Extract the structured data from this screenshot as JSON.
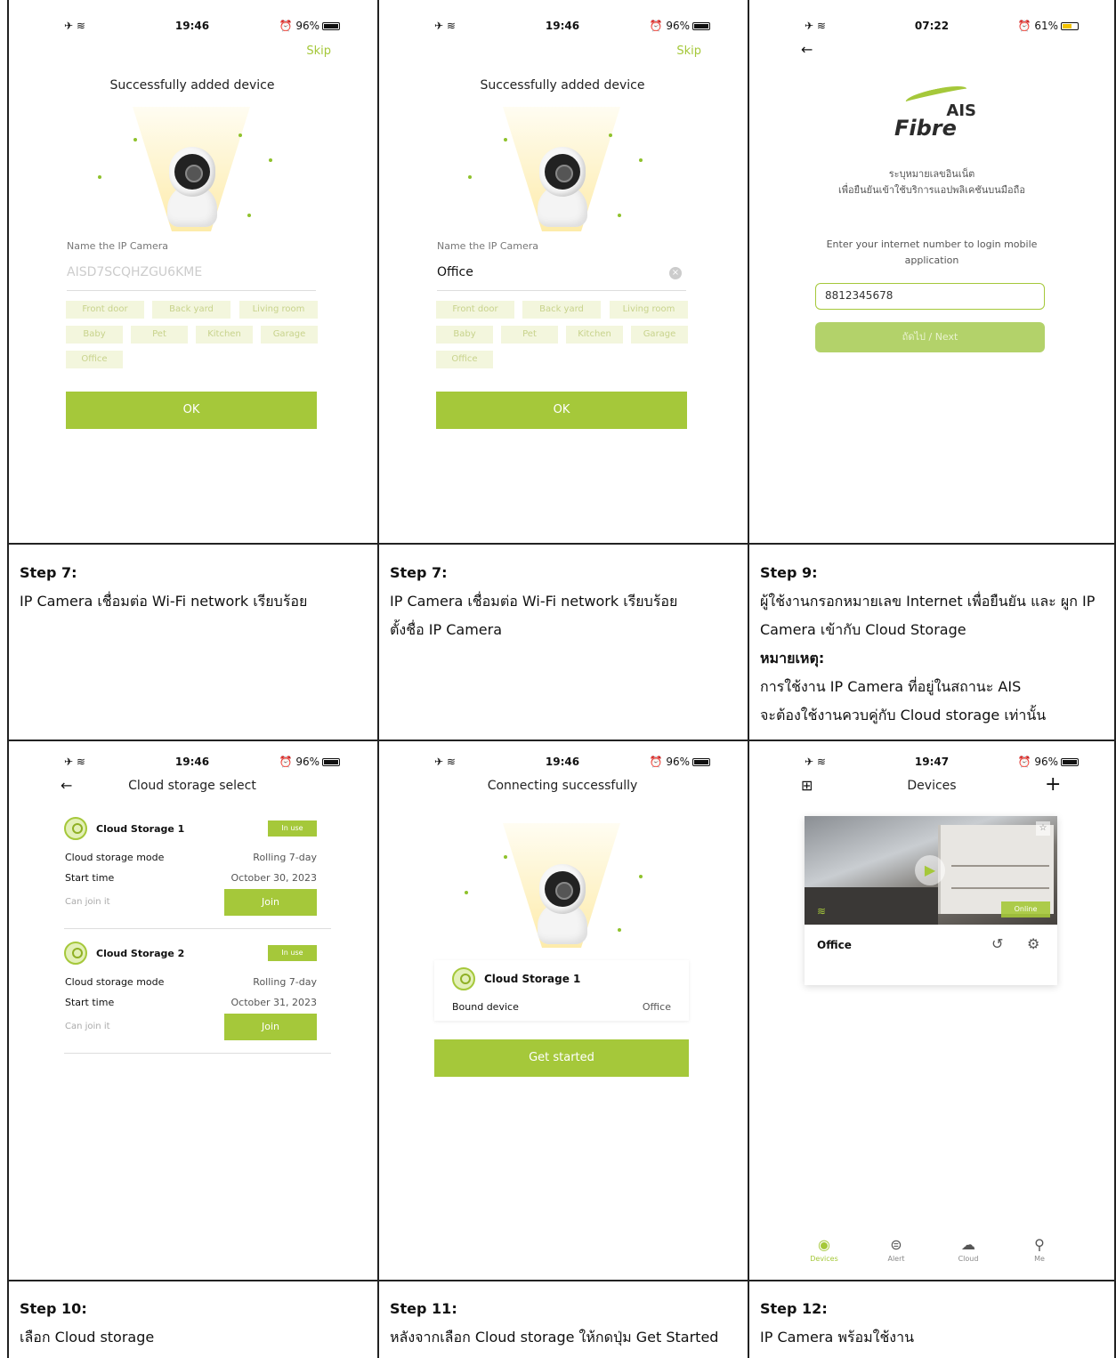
{
  "status_a": {
    "time": "19:46",
    "battery": "96%"
  },
  "status_b": {
    "time": "07:22",
    "battery": "61%"
  },
  "status_c": {
    "time": "19:47",
    "battery": "96%"
  },
  "skip_label": "Skip",
  "added_title": "Successfully added device",
  "name_label": "Name the IP Camera",
  "name_placeholder": "AISD7SCQHZGU6KME",
  "name_value": "Office",
  "chips": [
    "Front door",
    "Back yard",
    "Living room",
    "Baby",
    "Pet",
    "Kitchen",
    "Garage",
    "Office"
  ],
  "ok_label": "OK",
  "ais": {
    "brand_top": "AIS",
    "brand_bottom": "Fibre",
    "thai_line1": "ระบุหมายเลขอินเน็ต",
    "thai_line2": "เพื่อยืนยันเข้าใช้บริการแอปพลิเคชันบนมือถือ",
    "en_line1": "Enter your internet number to login mobile",
    "en_line2": "application",
    "input_value": "8812345678",
    "next_label": "ถัดไป / Next"
  },
  "cloud_select": {
    "title": "Cloud storage select",
    "items": [
      {
        "name": "Cloud Storage 1",
        "badge": "In use",
        "mode_label": "Cloud storage mode",
        "mode_value": "Rolling 7-day",
        "start_label": "Start time",
        "start_value": "October 30, 2023",
        "join_hint": "Can join it",
        "join_label": "Join"
      },
      {
        "name": "Cloud Storage 2",
        "badge": "In use",
        "mode_label": "Cloud storage mode",
        "mode_value": "Rolling 7-day",
        "start_label": "Start time",
        "start_value": "October 31, 2023",
        "join_hint": "Can join it",
        "join_label": "Join"
      }
    ]
  },
  "connecting": {
    "title": "Connecting successfully",
    "storage_name": "Cloud Storage 1",
    "bound_label": "Bound device",
    "bound_value": "Office",
    "start_label": "Get started"
  },
  "devices": {
    "title": "Devices",
    "device_name": "Office",
    "online_label": "Online",
    "nav": [
      "Devices",
      "Alert",
      "Cloud",
      "Me"
    ]
  },
  "captions": {
    "c1": {
      "step": "Step 7:",
      "line1": "IP Camera เชื่อมต่อ Wi-Fi network เรียบร้อย"
    },
    "c2": {
      "step": "Step 7:",
      "line1": "IP Camera เชื่อมต่อ Wi-Fi network เรียบร้อย",
      "line2": "ตั้งชื่อ IP Camera"
    },
    "c3": {
      "step": "Step 9:",
      "line1": "ผู้ใช้งานกรอกหมายเลข Internet เพื่อยืนยัน และ ผูก IP",
      "line2": "Camera เข้ากับ Cloud Storage",
      "note": "หมายเหตุ:",
      "line3": "การใช้งาน IP Camera ที่อยู่ในสถานะ AIS",
      "line4": "จะต้องใช้งานควบคู่กับ Cloud storage เท่านั้น"
    },
    "c4": {
      "step": "Step 10:",
      "line1": "เลือก Cloud storage"
    },
    "c5": {
      "step": "Step 11:",
      "line1": "หลังจากเลือก Cloud storage ให้กดปุ่ม Get Started"
    },
    "c6": {
      "step": "Step 12:",
      "line1": "IP Camera พร้อมใช้งาน"
    }
  }
}
